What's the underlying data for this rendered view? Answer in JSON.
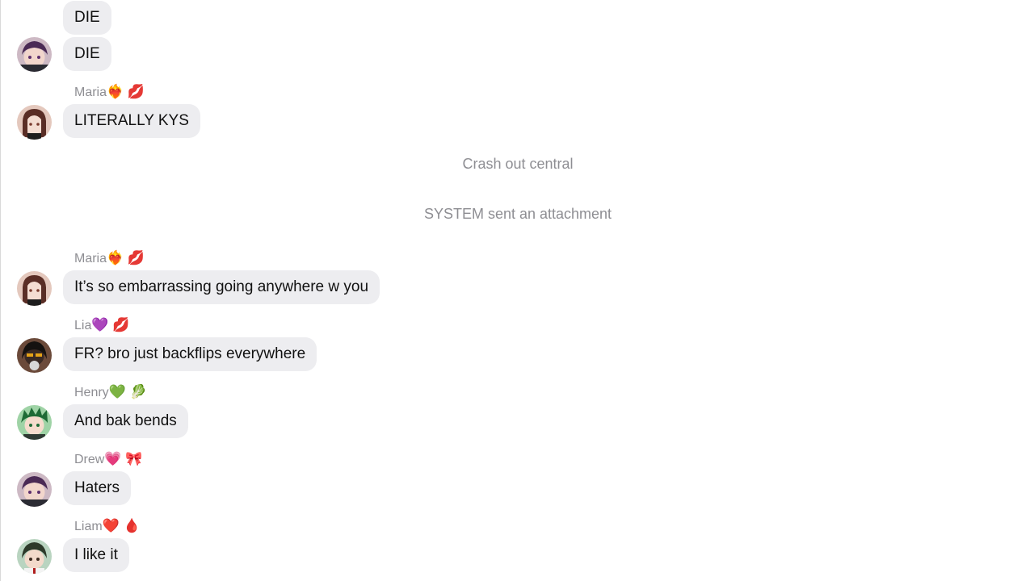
{
  "messages": [
    {
      "text": "DIE"
    },
    {
      "text": "DIE",
      "avatar": "purple-hair-avatar"
    },
    {
      "sender": "Maria",
      "sender_emoji": "❤️‍🔥 💋",
      "text": "LITERALLY KYS",
      "avatar": "brown-hair-avatar"
    },
    {
      "sender": "Maria",
      "sender_emoji": "❤️‍🔥 💋",
      "text": "It’s so embarrassing going anywhere w you",
      "avatar": "brown-hair-avatar"
    },
    {
      "sender": "Lia",
      "sender_emoji": "💜 💋",
      "text": "FR? bro just backflips everywhere",
      "avatar": "dark-hair-avatar"
    },
    {
      "sender": "Henry",
      "sender_emoji": "💚 🥬",
      "text": "And bak bends",
      "avatar": "green-hair-avatar"
    },
    {
      "sender": "Drew",
      "sender_emoji": "💗 🎀",
      "text": "Haters",
      "avatar": "purple-hair-avatar"
    },
    {
      "sender": "Liam",
      "sender_emoji": "❤️ 🩸",
      "text": "I like it",
      "avatar": "dark-green-hair-avatar"
    }
  ],
  "system": {
    "chat_name": "Crash out central",
    "attachment_notice": "SYSTEM sent an attachment"
  }
}
